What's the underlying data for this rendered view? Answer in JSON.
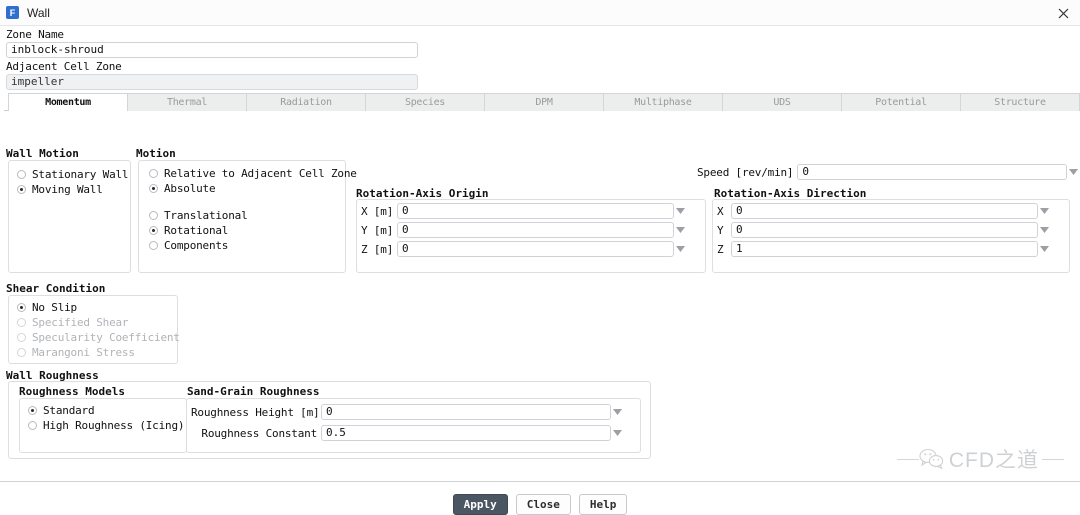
{
  "window": {
    "title": "Wall",
    "icon": "fluent-f-icon",
    "close_icon": "close-icon"
  },
  "colors": {
    "accent": "#2f6fd0",
    "primary_button": "#4b5663",
    "field_border": "#cfd2d6",
    "disabled_text": "#b0b3b7"
  },
  "top_fields": {
    "zone_name_label": "Zone Name",
    "zone_name_value": "inblock-shroud",
    "adjacent_cell_zone_label": "Adjacent Cell Zone",
    "adjacent_cell_zone_value": "impeller"
  },
  "tabs": [
    {
      "label": "Momentum",
      "active": true
    },
    {
      "label": "Thermal",
      "active": false
    },
    {
      "label": "Radiation",
      "active": false
    },
    {
      "label": "Species",
      "active": false
    },
    {
      "label": "DPM",
      "active": false
    },
    {
      "label": "Multiphase",
      "active": false
    },
    {
      "label": "UDS",
      "active": false
    },
    {
      "label": "Potential",
      "active": false
    },
    {
      "label": "Structure",
      "active": false
    }
  ],
  "wall_motion": {
    "title": "Wall Motion",
    "options": [
      {
        "label": "Stationary Wall",
        "selected": false
      },
      {
        "label": "Moving Wall",
        "selected": true
      }
    ]
  },
  "motion": {
    "title": "Motion",
    "frame_options": [
      {
        "label": "Relative to Adjacent Cell Zone",
        "selected": false
      },
      {
        "label": "Absolute",
        "selected": true
      }
    ],
    "type_options": [
      {
        "label": "Translational",
        "selected": false
      },
      {
        "label": "Rotational",
        "selected": true
      },
      {
        "label": "Components",
        "selected": false
      }
    ]
  },
  "speed": {
    "label": "Speed [rev/min]",
    "value": "0"
  },
  "rotation_axis_origin": {
    "title": "Rotation-Axis Origin",
    "rows": [
      {
        "label": "X [m]",
        "value": "0"
      },
      {
        "label": "Y [m]",
        "value": "0"
      },
      {
        "label": "Z [m]",
        "value": "0"
      }
    ]
  },
  "rotation_axis_direction": {
    "title": "Rotation-Axis Direction",
    "rows": [
      {
        "label": "X",
        "value": "0"
      },
      {
        "label": "Y",
        "value": "0"
      },
      {
        "label": "Z",
        "value": "1"
      }
    ]
  },
  "shear_condition": {
    "title": "Shear Condition",
    "options": [
      {
        "label": "No Slip",
        "selected": true,
        "disabled": false
      },
      {
        "label": "Specified Shear",
        "selected": false,
        "disabled": true
      },
      {
        "label": "Specularity Coefficient",
        "selected": false,
        "disabled": true
      },
      {
        "label": "Marangoni Stress",
        "selected": false,
        "disabled": true
      }
    ]
  },
  "wall_roughness": {
    "title": "Wall Roughness",
    "roughness_models": {
      "title": "Roughness Models",
      "options": [
        {
          "label": "Standard",
          "selected": true
        },
        {
          "label": "High Roughness (Icing)",
          "selected": false
        }
      ]
    },
    "sand_grain_roughness": {
      "title": "Sand-Grain Roughness",
      "rows": [
        {
          "label": "Roughness Height [m]",
          "value": "0"
        },
        {
          "label": "Roughness Constant",
          "value": "0.5"
        }
      ]
    }
  },
  "buttons": [
    {
      "label": "Apply",
      "primary": true
    },
    {
      "label": "Close",
      "primary": false
    },
    {
      "label": "Help",
      "primary": false
    }
  ],
  "watermark": {
    "text": "CFD之道",
    "icon": "wechat-icon"
  }
}
